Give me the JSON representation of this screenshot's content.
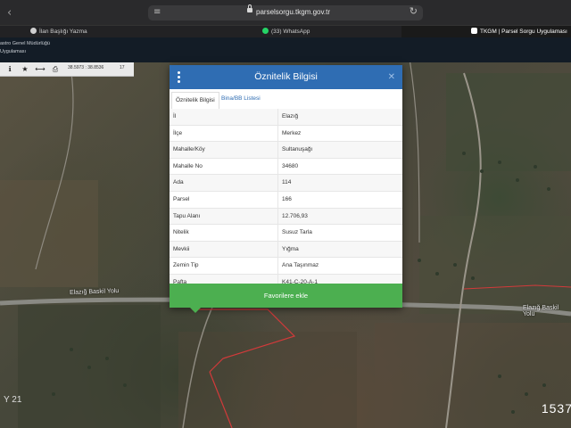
{
  "browser": {
    "url": "parselsorgu.tkgm.gov.tr",
    "tabs": [
      {
        "label": "İlan Başlığı Yazma"
      },
      {
        "label": "(33) WhatsApp"
      },
      {
        "label": "TKGM | Parsel Sorgu Uygulaması"
      }
    ]
  },
  "site": {
    "org_line1": "astro Genel Müdürlüğü",
    "org_line2": " Uygulaması"
  },
  "toolbar": {
    "coords": "38.5973 : 38.8536",
    "zoom": "17"
  },
  "map": {
    "road_left": "Elazığ Baskil Yolu",
    "road_right": "Elazığ Baskil Yolu",
    "watermark": "1537",
    "year": "Y 21"
  },
  "modal": {
    "title": "Öznitelik Bilgisi",
    "tabs": [
      {
        "label": "Öznitelik Bilgisi"
      },
      {
        "label": "Bina/BB Listesi"
      }
    ],
    "rows": [
      {
        "key": "İl",
        "value": "Elazığ"
      },
      {
        "key": "İlçe",
        "value": "Merkez"
      },
      {
        "key": "Mahalle/Köy",
        "value": "Sultanuşağı"
      },
      {
        "key": "Mahalle No",
        "value": "34680"
      },
      {
        "key": "Ada",
        "value": "114"
      },
      {
        "key": "Parsel",
        "value": "166"
      },
      {
        "key": "Tapu Alanı",
        "value": "12.706,93"
      },
      {
        "key": "Nitelik",
        "value": "Susuz Tarla"
      },
      {
        "key": "Mevkii",
        "value": "Yığma"
      },
      {
        "key": "Zemin Tip",
        "value": "Ana Taşınmaz"
      },
      {
        "key": "Pafta",
        "value": "K41-C-20-A-1"
      }
    ],
    "favorite_button": "Favorilere ekle"
  }
}
